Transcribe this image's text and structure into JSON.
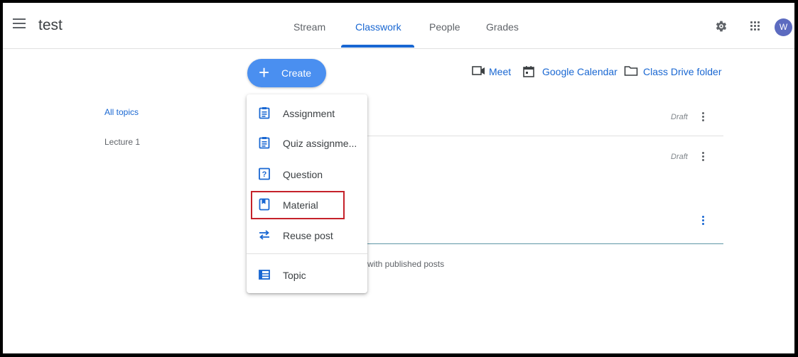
{
  "header": {
    "class_name": "test",
    "tabs": [
      {
        "label": "Stream"
      },
      {
        "label": "Classwork"
      },
      {
        "label": "People"
      },
      {
        "label": "Grades"
      }
    ],
    "active_tab": "Classwork",
    "avatar_initial": "W"
  },
  "toolbar": {
    "create_label": "Create",
    "meet_label": "Meet",
    "calendar_label": "Google Calendar",
    "drive_label": "Class Drive folder"
  },
  "topics": {
    "all": "All topics",
    "items": [
      "Lecture 1"
    ]
  },
  "stream": {
    "draft_label": "Draft",
    "published_text": "with published posts"
  },
  "create_menu": {
    "items": [
      {
        "label": "Assignment",
        "icon": "assignment-icon"
      },
      {
        "label": "Quiz assignme...",
        "icon": "quiz-icon"
      },
      {
        "label": "Question",
        "icon": "question-icon"
      },
      {
        "label": "Material",
        "icon": "material-icon"
      },
      {
        "label": "Reuse post",
        "icon": "reuse-icon"
      },
      {
        "label": "Topic",
        "icon": "topic-icon"
      }
    ],
    "highlighted_item": "Material"
  },
  "colors": {
    "accent": "#1967d2",
    "create_button": "#4a8ff0",
    "highlight_border": "#c5222a",
    "avatar": "#5c6bc0"
  }
}
